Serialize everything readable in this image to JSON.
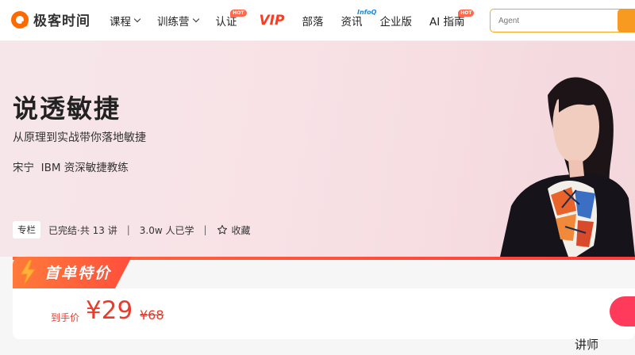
{
  "logo": {
    "text": "极客时间"
  },
  "nav": {
    "items": [
      {
        "label": "课程",
        "dropdown": true
      },
      {
        "label": "训练营",
        "dropdown": true
      },
      {
        "label": "认证",
        "badge": "HOT"
      },
      {
        "label": "VIP"
      },
      {
        "label": "部落"
      },
      {
        "label": "资讯",
        "badge": "InfoQ"
      },
      {
        "label": "企业版"
      },
      {
        "label": "AI 指南",
        "badge": "HOT"
      }
    ]
  },
  "search": {
    "placeholder": "Agent"
  },
  "course": {
    "title": "说透敏捷",
    "subtitle": "从原理到实战带你落地敏捷",
    "author": "宋宁  IBM 资深敏捷教练",
    "tag": "专栏",
    "status": "已完结·共 13 讲",
    "learners": "3.0w 人已学",
    "favorite": "收藏"
  },
  "promo": {
    "badge": "首单特价",
    "final_label": "到手价",
    "price": "¥29",
    "original_price": "¥68"
  },
  "section": {
    "lecturer": "讲师"
  },
  "colors": {
    "accent": "#ff6a00",
    "price_red": "#ea3b2b",
    "search_border": "#f5a623"
  }
}
